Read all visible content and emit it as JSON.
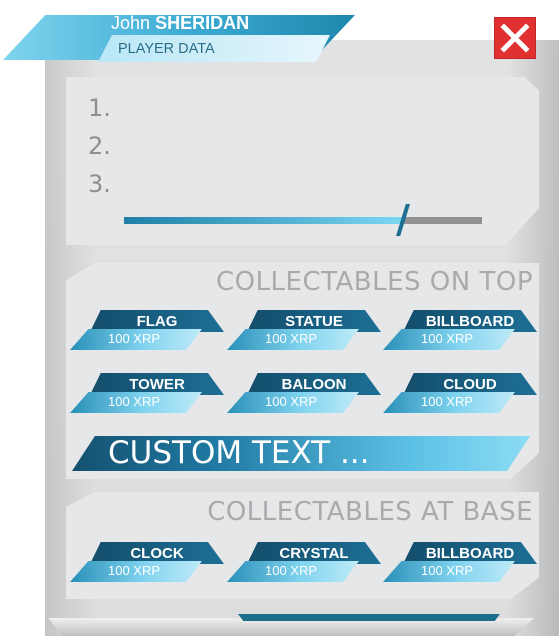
{
  "header": {
    "first_name": "John",
    "last_name": "SHERIDAN",
    "subtitle": "PLAYER DATA"
  },
  "close_button": {
    "icon": "close-icon",
    "color": "#e03030"
  },
  "player_data": {
    "list": [
      "1.",
      "2.",
      "3."
    ],
    "progress": 0.78
  },
  "collectables_top": {
    "title": "COLLECTABLES ON TOP",
    "items": [
      {
        "name": "FLAG",
        "price": "100 XRP"
      },
      {
        "name": "STATUE",
        "price": "100 XRP"
      },
      {
        "name": "BILLBOARD",
        "price": "100 XRP"
      },
      {
        "name": "TOWER",
        "price": "100 XRP"
      },
      {
        "name": "BALOON",
        "price": "100 XRP"
      },
      {
        "name": "CLOUD",
        "price": "100 XRP"
      }
    ],
    "custom_text": "CUSTOM TEXT ..."
  },
  "collectables_base": {
    "title": "COLLECTABLES AT BASE",
    "items": [
      {
        "name": "CLOCK",
        "price": "100 XRP"
      },
      {
        "name": "CRYSTAL",
        "price": "100 XRP"
      },
      {
        "name": "BILLBOARD",
        "price": "100 XRP"
      }
    ]
  },
  "colors": {
    "accent_dark": "#1d6f95",
    "accent_light": "#7fd3ef",
    "panel": "#e6e7e8",
    "close": "#e03030"
  }
}
